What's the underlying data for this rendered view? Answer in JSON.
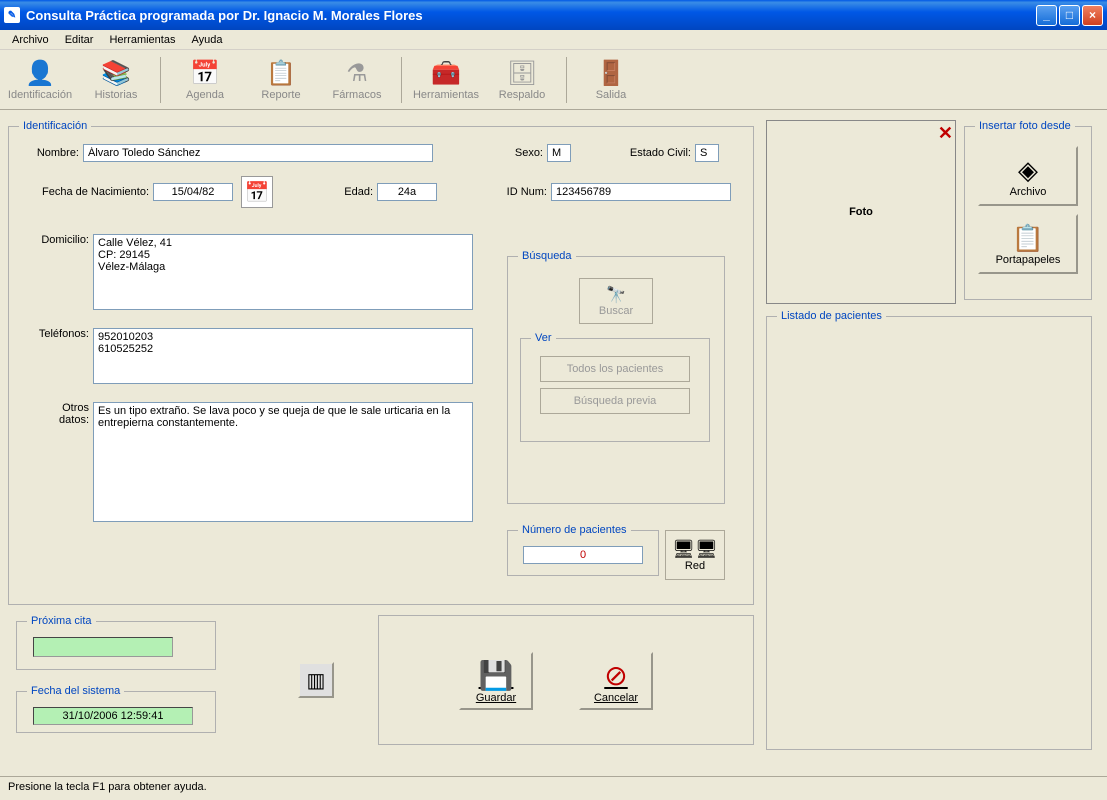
{
  "titlebar": {
    "title": "Consulta Práctica programada por Dr. Ignacio M. Morales Flores"
  },
  "menu": {
    "archivo": "Archivo",
    "editar": "Editar",
    "herramientas": "Herramientas",
    "ayuda": "Ayuda"
  },
  "toolbar": {
    "identificacion": "Identificación",
    "historias": "Historias",
    "agenda": "Agenda",
    "reporte": "Reporte",
    "farmacos": "Fármacos",
    "herramientas": "Herramientas",
    "respaldo": "Respaldo",
    "salida": "Salida"
  },
  "identificacion": {
    "legend": "Identificación",
    "nombre_label": "Nombre:",
    "nombre": "Álvaro Toledo Sánchez",
    "sexo_label": "Sexo:",
    "sexo": "M",
    "estado_label": "Estado Civil:",
    "estado": "S",
    "fnac_label": "Fecha de Nacimiento:",
    "fnac": "15/04/82",
    "edad_label": "Edad:",
    "edad": "24a",
    "idnum_label": "ID Num:",
    "idnum": "123456789",
    "domicilio_label": "Domicilio:",
    "domicilio": "Calle Vélez, 41\nCP: 29145\nVélez-Málaga",
    "telefonos_label": "Teléfonos:",
    "telefonos": "952010203\n610525252",
    "otros_label": "Otros\ndatos:",
    "otros": "Es un tipo extraño. Se lava poco y se queja de que le sale urticaria en la entrepierna constantemente."
  },
  "busqueda": {
    "legend": "Búsqueda",
    "buscar": "Buscar",
    "ver_legend": "Ver",
    "todos": "Todos los pacientes",
    "previa": "Búsqueda previa"
  },
  "numpacientes": {
    "legend": "Número de pacientes",
    "value": "0"
  },
  "red": {
    "label": "Red"
  },
  "foto": {
    "label": "Foto"
  },
  "insertar": {
    "legend": "Insertar foto desde",
    "archivo": "Archivo",
    "portapapeles": "Portapapeles"
  },
  "listado": {
    "legend": "Listado de pacientes"
  },
  "proxima": {
    "legend": "Próxima cita",
    "value": ""
  },
  "fechasis": {
    "legend": "Fecha del sistema",
    "value": "31/10/2006 12:59:41"
  },
  "actions": {
    "guardar": "Guardar",
    "cancelar": "Cancelar"
  },
  "statusbar": {
    "text": "Presione la tecla F1 para obtener ayuda."
  }
}
